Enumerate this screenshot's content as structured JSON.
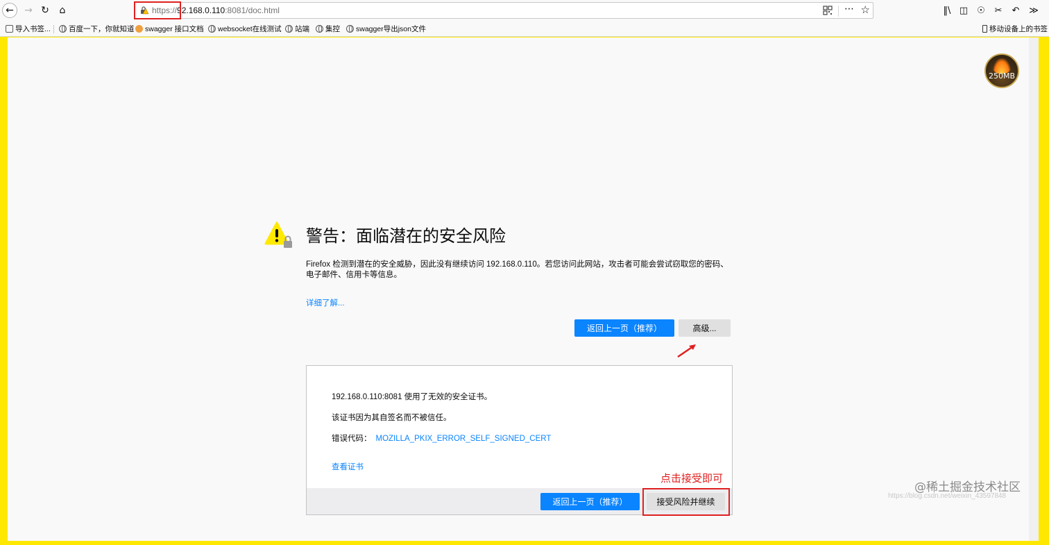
{
  "browser": {
    "url": {
      "protocol": "https://",
      "host": "92.168.0.110",
      "path": ":8081/doc.html"
    },
    "toolbar_icons": [
      "back-icon",
      "forward-icon",
      "reload-icon",
      "home-icon",
      "qr-code-icon",
      "more-icon",
      "star-icon",
      "library-icon",
      "sidebar-icon",
      "account-icon",
      "crop-icon",
      "undo-icon"
    ]
  },
  "bookmarks": {
    "import": "导入书签...",
    "items": [
      {
        "label": "百度一下，你就知道",
        "icon": "globe-icon"
      },
      {
        "label": "swagger 接口文档",
        "icon": "swagger-icon"
      },
      {
        "label": "websocket在线测试",
        "icon": "globe-icon"
      },
      {
        "label": "站端",
        "icon": "globe-icon"
      },
      {
        "label": "集控",
        "icon": "globe-icon"
      },
      {
        "label": "swagger导出json文件",
        "icon": "globe-icon"
      }
    ],
    "mobile": "移动设备上的书签"
  },
  "memory_badge": "250MB",
  "warning": {
    "title": "警告：面临潜在的安全风险",
    "description": "Firefox 检测到潜在的安全威胁，因此没有继续访问 192.168.0.110。若您访问此网站，攻击者可能会尝试窃取您的密码、电子邮件、信用卡等信息。",
    "learn_more": "详细了解...",
    "back_button": "返回上一页（推荐）",
    "advanced_button": "高级..."
  },
  "advanced": {
    "line1": "192.168.0.110:8081 使用了无效的安全证书。",
    "line2": "该证书因为其自签名而不被信任。",
    "error_label": "错误代码：",
    "error_code": "MOZILLA_PKIX_ERROR_SELF_SIGNED_CERT",
    "view_cert": "查看证书",
    "back_button": "返回上一页（推荐）",
    "accept_button": "接受风险并继续",
    "annotation": "点击接受即可"
  },
  "watermark": {
    "text": "@稀土掘金技术社区",
    "subtext": "https://blog.csdn.net/weixin_43597848"
  },
  "colors": {
    "accent": "#0a84ff",
    "highlight": "#e02020",
    "frame": "#ffe800"
  }
}
